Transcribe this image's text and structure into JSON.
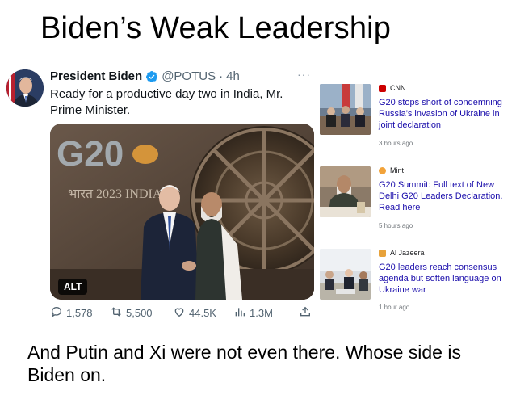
{
  "headline": "Biden’s Weak Leadership",
  "tweet": {
    "name": "President Biden",
    "handle": "@POTUS",
    "separator": "·",
    "time": "4h",
    "more": "···",
    "text": "Ready for a productive day two in India, Mr. Prime Minister.",
    "media": {
      "backdrop_text": "भारत 2023 INDIA",
      "logo_text": "G20",
      "alt_badge": "ALT"
    },
    "actions": {
      "replies": "1,578",
      "retweets": "5,500",
      "likes": "44.5K",
      "views": "1.3M"
    },
    "colors": {
      "verified": "#1d9bf0",
      "meta": "#536471"
    }
  },
  "news": [
    {
      "source": "CNN",
      "logo_color": "#cc0000",
      "title": "G20 stops short of condemning Russia’s invasion of Ukraine in joint declaration",
      "time": "3 hours ago"
    },
    {
      "source": "Mint",
      "logo_color": "#f2a33a",
      "title": "G20 Summit: Full text of New Delhi G20 Leaders Declaration. Read here",
      "time": "5 hours ago"
    },
    {
      "source": "Al Jazeera",
      "logo_color": "#e7a23b",
      "title": "G20 leaders reach consensus agenda but soften language on Ukraine war",
      "time": "1 hour ago"
    }
  ],
  "caption": "And Putin and Xi were not even there. Whose side is Biden on."
}
